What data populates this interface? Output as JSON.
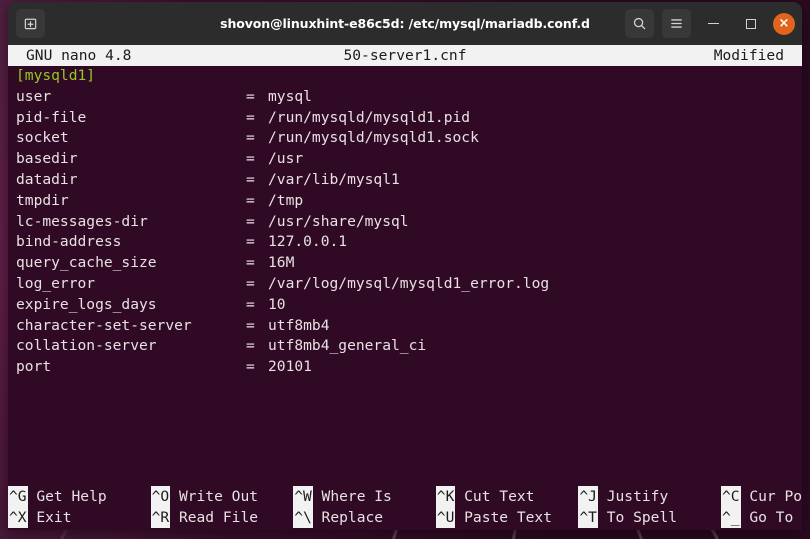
{
  "desktop": {
    "wallpaper_color": "#4a0f33"
  },
  "window": {
    "titlebar": {
      "new_tab_icon": "new-tab-icon",
      "title": "shovon@linuxhint-e86c5d: /etc/mysql/mariadb.conf.d",
      "search_icon": "search-icon",
      "menu_icon": "hamburger-menu-icon",
      "minimize_label": "minimize",
      "maximize_label": "maximize",
      "close_label": "×",
      "close_color": "#e0641b",
      "background_color": "#2c2c2c"
    }
  },
  "terminal": {
    "background_color": "#300a24",
    "foreground_color": "#e8e1e4",
    "section_color": "#95c822"
  },
  "nano": {
    "header": {
      "version": "GNU nano 4.8",
      "filename": "50-server1.cnf",
      "status": "Modified"
    },
    "section_header": "[mysqld1]",
    "config": [
      {
        "key": "user",
        "eq": "=",
        "value": "mysql"
      },
      {
        "key": "pid-file",
        "eq": "=",
        "value": "/run/mysqld/mysqld1.pid"
      },
      {
        "key": "socket",
        "eq": "=",
        "value": "/run/mysqld/mysqld1.sock"
      },
      {
        "key": "basedir",
        "eq": "=",
        "value": "/usr"
      },
      {
        "key": "datadir",
        "eq": "=",
        "value": "/var/lib/mysql1"
      },
      {
        "key": "tmpdir",
        "eq": "=",
        "value": "/tmp"
      },
      {
        "key": "lc-messages-dir",
        "eq": "=",
        "value": "/usr/share/mysql"
      },
      {
        "key": "bind-address",
        "eq": "=",
        "value": "127.0.0.1"
      },
      {
        "key": "query_cache_size",
        "eq": "=",
        "value": "16M"
      },
      {
        "key": "log_error",
        "eq": "=",
        "value": "/var/log/mysql/mysqld1_error.log"
      },
      {
        "key": "expire_logs_days",
        "eq": "=",
        "value": "10"
      },
      {
        "key": "character-set-server",
        "eq": "=",
        "value": "utf8mb4"
      },
      {
        "key": "collation-server",
        "eq": "=",
        "value": "utf8mb4_general_ci"
      },
      {
        "key": "port",
        "eq": "=",
        "value": "20101"
      }
    ],
    "shortcuts_row1": [
      {
        "key": "^G",
        "label": "Get Help"
      },
      {
        "key": "^O",
        "label": "Write Out"
      },
      {
        "key": "^W",
        "label": "Where Is"
      },
      {
        "key": "^K",
        "label": "Cut Text"
      },
      {
        "key": "^J",
        "label": "Justify"
      },
      {
        "key": "^C",
        "label": "Cur Pos"
      }
    ],
    "shortcuts_row2": [
      {
        "key": "^X",
        "label": "Exit"
      },
      {
        "key": "^R",
        "label": "Read File"
      },
      {
        "key": "^\\",
        "label": "Replace"
      },
      {
        "key": "^U",
        "label": "Paste Text"
      },
      {
        "key": "^T",
        "label": "To Spell"
      },
      {
        "key": "^_",
        "label": "Go To Line"
      }
    ]
  }
}
